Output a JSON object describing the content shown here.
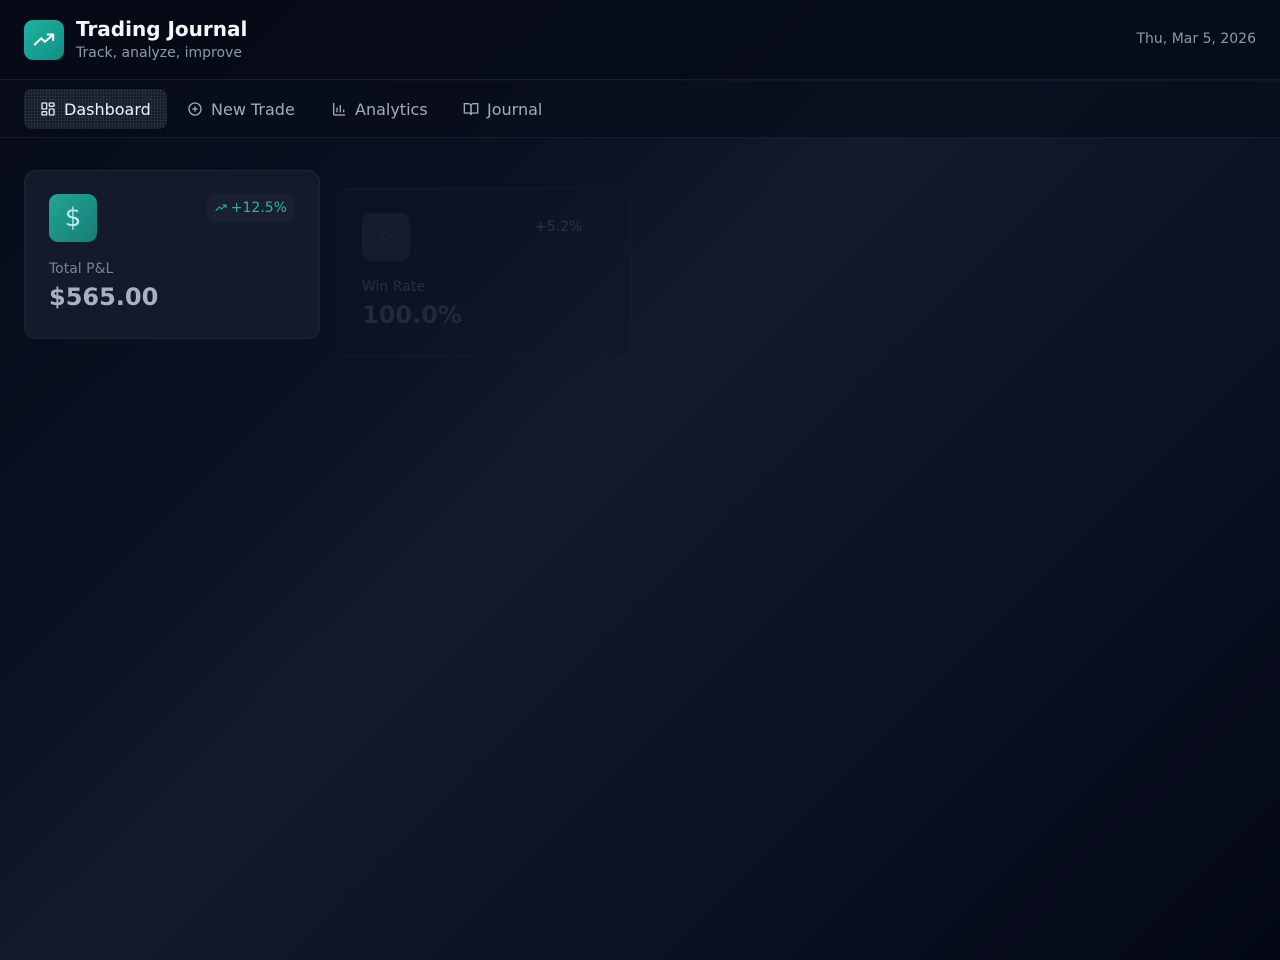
{
  "header": {
    "title": "Trading Journal",
    "subtitle": "Track, analyze, improve",
    "date": "Thu, Mar 5, 2026",
    "logo_icon": "trending-up-icon"
  },
  "nav": {
    "items": [
      {
        "label": "Dashboard",
        "icon": "layout-grid-icon",
        "active": true
      },
      {
        "label": "New Trade",
        "icon": "plus-circle-icon",
        "active": false
      },
      {
        "label": "Analytics",
        "icon": "bar-chart-icon",
        "active": false
      },
      {
        "label": "Journal",
        "icon": "book-open-icon",
        "active": false
      }
    ]
  },
  "stats": [
    {
      "label": "Total P&L",
      "value": "$565.00",
      "change": "+12.5%",
      "icon": "dollar-icon",
      "symbol": "$"
    },
    {
      "label": "Win Rate",
      "value": "100.0%",
      "change": "+5.2%",
      "icon": "target-icon",
      "symbol": "·.·"
    }
  ],
  "colors": {
    "accent": "#20b2a0",
    "background": "#0b1122",
    "positive": "#2fb39f"
  }
}
